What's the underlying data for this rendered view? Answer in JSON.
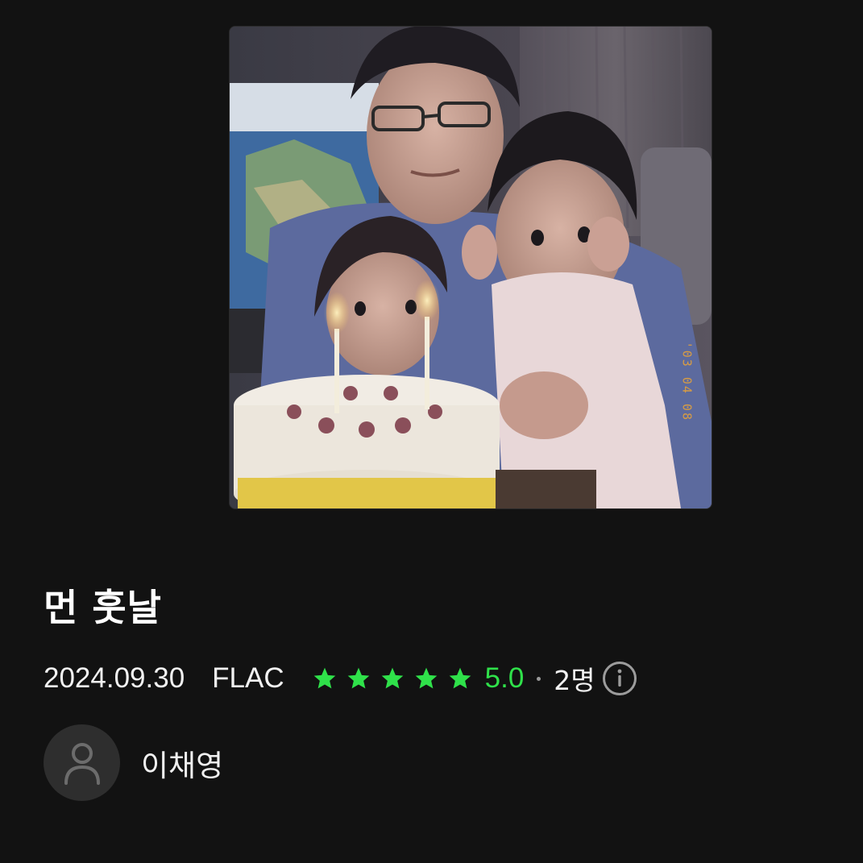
{
  "album": {
    "cover_stamp": "'03 04 08",
    "title": "먼 훗날",
    "release_date": "2024.09.30",
    "format": "FLAC"
  },
  "rating": {
    "stars_filled": 5,
    "stars_total": 5,
    "value": "5.0",
    "count": "2명",
    "accent_color": "#2fe14a",
    "info_icon": "info-circle-icon"
  },
  "artist": {
    "name": "이채영",
    "avatar_icon": "person-placeholder-icon"
  }
}
